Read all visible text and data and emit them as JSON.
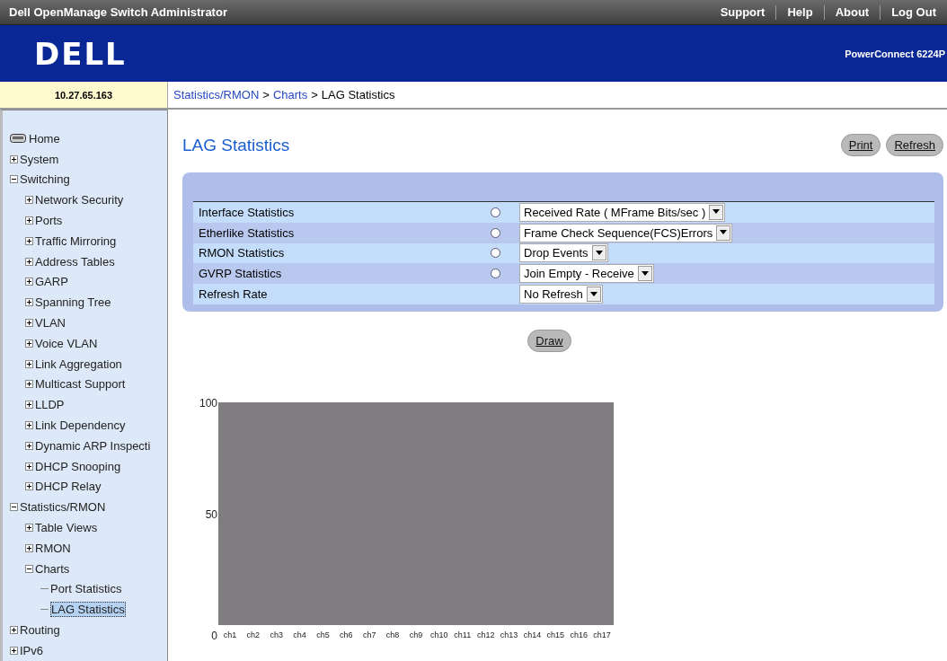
{
  "topbar": {
    "title": "Dell OpenManage Switch Administrator",
    "links": [
      "Support",
      "Help",
      "About",
      "Log Out"
    ]
  },
  "header": {
    "logo": "DELL",
    "model": "PowerConnect 6224P"
  },
  "address": "10.27.65.163",
  "breadcrumb": {
    "links": [
      "Statistics/RMON",
      "Charts"
    ],
    "separator": ">",
    "current": "LAG Statistics"
  },
  "sidebar": {
    "items": [
      {
        "label": "Home",
        "kind": "home"
      },
      {
        "label": "System",
        "kind": "folder",
        "expanded": false
      },
      {
        "label": "Switching",
        "kind": "folder",
        "expanded": true,
        "children": [
          {
            "label": "Network Security",
            "kind": "folder",
            "expanded": false
          },
          {
            "label": "Ports",
            "kind": "folder",
            "expanded": false
          },
          {
            "label": "Traffic Mirroring",
            "kind": "folder",
            "expanded": false
          },
          {
            "label": "Address Tables",
            "kind": "folder",
            "expanded": false
          },
          {
            "label": "GARP",
            "kind": "folder",
            "expanded": false
          },
          {
            "label": "Spanning Tree",
            "kind": "folder",
            "expanded": false
          },
          {
            "label": "VLAN",
            "kind": "folder",
            "expanded": false
          },
          {
            "label": "Voice VLAN",
            "kind": "folder",
            "expanded": false
          },
          {
            "label": "Link Aggregation",
            "kind": "folder",
            "expanded": false
          },
          {
            "label": "Multicast Support",
            "kind": "folder",
            "expanded": false
          },
          {
            "label": "LLDP",
            "kind": "folder",
            "expanded": false
          },
          {
            "label": "Link Dependency",
            "kind": "folder",
            "expanded": false
          },
          {
            "label": "Dynamic ARP Inspecti",
            "kind": "folder",
            "expanded": false
          },
          {
            "label": "DHCP Snooping",
            "kind": "folder",
            "expanded": false
          },
          {
            "label": "DHCP Relay",
            "kind": "folder",
            "expanded": false
          }
        ]
      },
      {
        "label": "Statistics/RMON",
        "kind": "folder",
        "expanded": true,
        "children": [
          {
            "label": "Table Views",
            "kind": "folder",
            "expanded": false
          },
          {
            "label": "RMON",
            "kind": "folder",
            "expanded": false
          },
          {
            "label": "Charts",
            "kind": "folder",
            "expanded": true,
            "children": [
              {
                "label": "Port Statistics",
                "kind": "page",
                "selected": false
              },
              {
                "label": "LAG Statistics",
                "kind": "page",
                "selected": true
              }
            ]
          }
        ]
      },
      {
        "label": "Routing",
        "kind": "folder",
        "expanded": false
      },
      {
        "label": "IPv6",
        "kind": "folder",
        "expanded": false
      }
    ]
  },
  "page": {
    "title": "LAG Statistics",
    "buttons": [
      "Print",
      "Refresh"
    ]
  },
  "form": {
    "rows": [
      {
        "label": "Interface Statistics",
        "kind": "radio-select",
        "selected": false,
        "value": "Received Rate ( MFrame Bits/sec )"
      },
      {
        "label": "Etherlike Statistics",
        "kind": "radio-select",
        "selected": false,
        "value": "Frame Check Sequence(FCS)Errors"
      },
      {
        "label": "RMON Statistics",
        "kind": "radio-select",
        "selected": false,
        "value": "Drop Events"
      },
      {
        "label": "GVRP Statistics",
        "kind": "radio-select",
        "selected": false,
        "value": "Join Empty - Receive"
      },
      {
        "label": "Refresh Rate",
        "kind": "select",
        "value": "No Refresh"
      }
    ]
  },
  "draw_button": "Draw",
  "chart": {
    "chart_data": {
      "type": "bar",
      "categories": [
        "ch1",
        "ch2",
        "ch3",
        "ch4",
        "ch5",
        "ch6",
        "ch7",
        "ch8",
        "ch9",
        "ch10",
        "ch11",
        "ch12",
        "ch13",
        "ch14",
        "ch15",
        "ch16",
        "ch17"
      ],
      "values": [
        0,
        0,
        0,
        0,
        0,
        0,
        0,
        0,
        0,
        0,
        0,
        0,
        0,
        0,
        0,
        0,
        0
      ],
      "ylim": [
        0,
        100
      ],
      "yticks": [
        0,
        50,
        100
      ]
    }
  }
}
